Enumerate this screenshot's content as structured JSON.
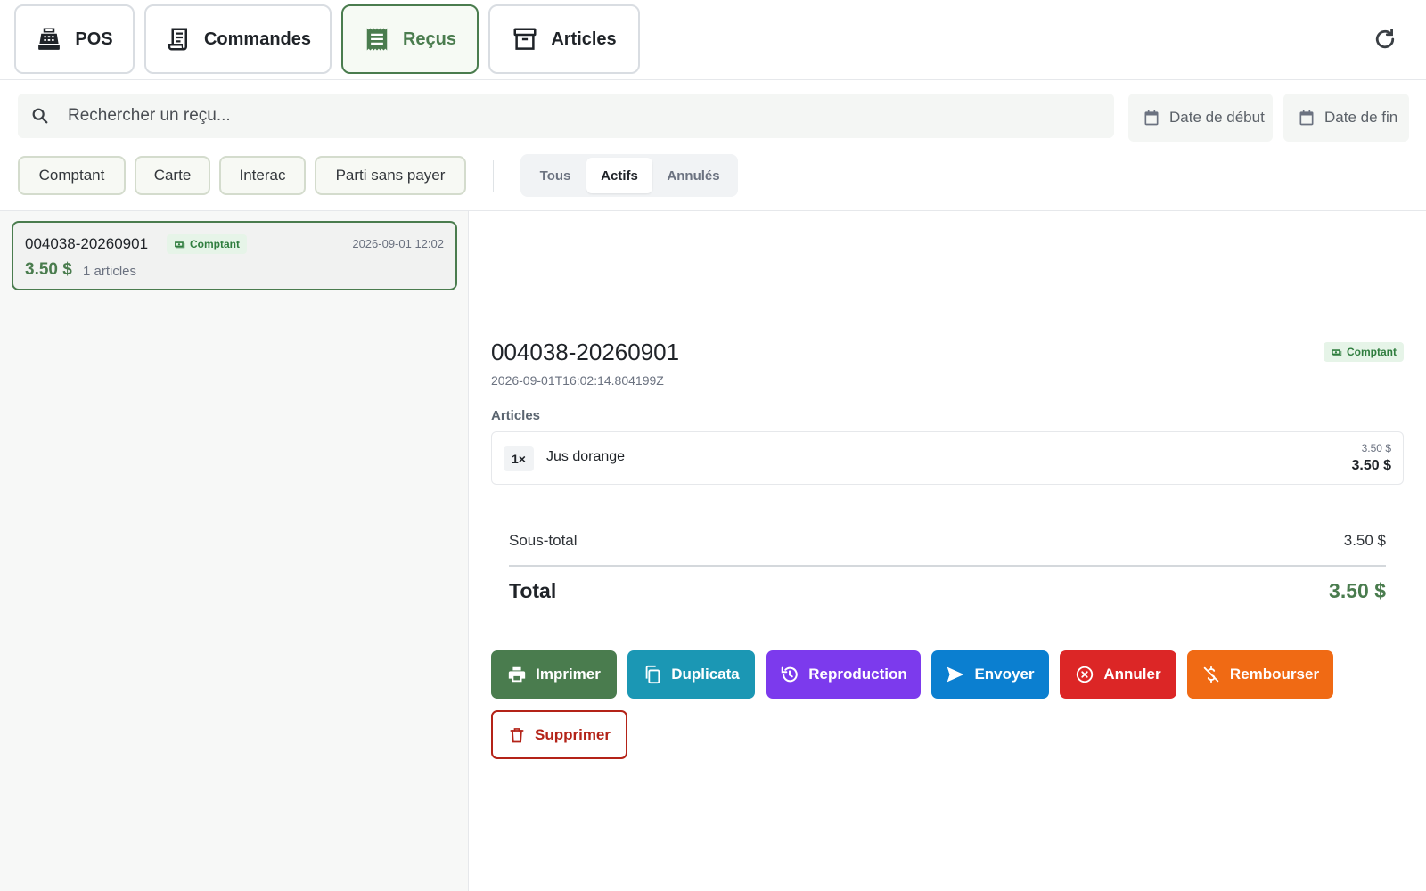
{
  "nav": {
    "tabs": [
      {
        "label": "POS",
        "icon": "cash-register-icon"
      },
      {
        "label": "Commandes",
        "icon": "order-list-icon"
      },
      {
        "label": "Reçus",
        "icon": "receipt-icon",
        "active": true
      },
      {
        "label": "Articles",
        "icon": "archive-box-icon"
      }
    ],
    "refresh_icon": "refresh-icon"
  },
  "search": {
    "placeholder": "Rechercher un reçu...",
    "value": ""
  },
  "dates": {
    "start_label": "Date de début",
    "end_label": "Date de fin"
  },
  "filters": {
    "payment_chips": [
      "Comptant",
      "Carte",
      "Interac",
      "Parti sans payer"
    ],
    "status_tabs": [
      "Tous",
      "Actifs",
      "Annulés"
    ],
    "status_active": "Actifs"
  },
  "receipts": [
    {
      "id": "004038-20260901",
      "payment": "Comptant",
      "date": "2026-09-01 12:02",
      "amount": "3.50 $",
      "items_count": "1 articles"
    }
  ],
  "detail": {
    "id": "004038-20260901",
    "payment": "Comptant",
    "timestamp": "2026-09-01T16:02:14.804199Z",
    "items_title": "Articles",
    "items": [
      {
        "qty": "1×",
        "name": "Jus dorange",
        "unit_price": "3.50 $",
        "line_total": "3.50 $"
      }
    ],
    "subtotal_label": "Sous-total",
    "subtotal_value": "3.50 $",
    "total_label": "Total",
    "total_value": "3.50 $"
  },
  "actions": {
    "print": "Imprimer",
    "duplicate": "Duplicata",
    "reproduce": "Reproduction",
    "send": "Envoyer",
    "cancel": "Annuler",
    "refund": "Rembourser",
    "delete": "Supprimer"
  },
  "colors": {
    "accent": "#4a7c4e",
    "print": "#4a7c4e",
    "duplicate": "#1b97b4",
    "reproduce": "#7c3aed",
    "send": "#0b7fd0",
    "cancel": "#dc2626",
    "refund": "#f06a14",
    "delete": "#b42318"
  }
}
